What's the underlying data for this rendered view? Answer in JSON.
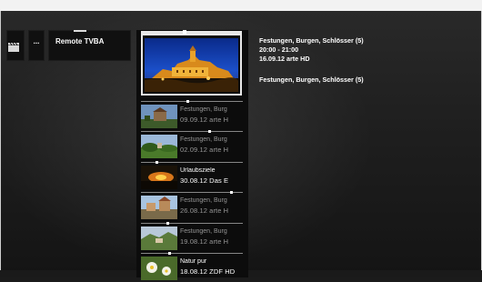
{
  "nav": {
    "more_label": "...",
    "remote_label": "Remote TVBA"
  },
  "focused": {
    "title": "Festungen, Burgen, Schlösser (5)",
    "time": "20:00 - 21:00",
    "date_channel": "16.09.12 arte HD",
    "subtitle": "Festungen, Burgen, Schlösser (5)"
  },
  "items": [
    {
      "line1": "Festungen, Burg",
      "line2": "09.09.12 arte H"
    },
    {
      "line1": "Festungen, Burg",
      "line2": "02.09.12 arte H"
    },
    {
      "line1": "Urlaubsziele",
      "line2": "30.08.12 Das E"
    },
    {
      "line1": "Festungen, Burg",
      "line2": "26.08.12 arte H"
    },
    {
      "line1": "Festungen, Burg",
      "line2": "19.08.12 arte H"
    },
    {
      "line1": "Natur pur",
      "line2": "18.08.12 ZDF HD"
    }
  ],
  "colors": {
    "focus_border": "#e8e8e8",
    "panel": "#0c0c0c"
  },
  "icons": [
    "clapperboard-icon"
  ]
}
